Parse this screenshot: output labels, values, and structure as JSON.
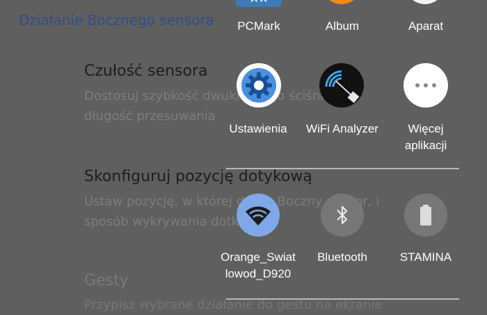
{
  "background": {
    "header": "Działanie Bocznego sensora",
    "items": [
      {
        "title": "Czułość sensora",
        "subtitle_line1": "Dostosuj szybkość dwukrotnego ściśnięcia i",
        "subtitle_line2": "długość przesuwania"
      },
      {
        "title": "Skonfiguruj pozycję dotykową",
        "subtitle_line1": "Ustaw pozycję, w której działa Boczny sensor, i",
        "subtitle_line2": "sposób wykrywania dotknięcia"
      },
      {
        "title": "Gesty",
        "subtitle_line1": "Przypisz wybrane działanie do gestu na ekranie"
      }
    ]
  },
  "overlay": {
    "top_apps": [
      {
        "label": "PCMark",
        "icon": "pcmark-icon"
      },
      {
        "label": "Album",
        "icon": "album-icon"
      },
      {
        "label": "Aparat",
        "icon": "camera-icon"
      }
    ],
    "apps": [
      {
        "label": "Ustawienia",
        "icon": "gear-icon",
        "color": "#4a90e2"
      },
      {
        "label": "WiFi Analyzer",
        "icon": "wifi-analyzer-icon",
        "color": "#1a1a1a"
      },
      {
        "label_line1": "Więcej",
        "label_line2": "aplikacji",
        "icon": "more-icon",
        "color": "#ffffff"
      }
    ],
    "toggles": [
      {
        "label_line1": "Orange_Swiat",
        "label_line2": "lowod_D920",
        "icon": "wifi-icon",
        "state": "on",
        "color": "#7fa8e8"
      },
      {
        "label": "Bluetooth",
        "icon": "bluetooth-icon",
        "state": "off"
      },
      {
        "label": "STAMINA",
        "icon": "battery-icon",
        "state": "off"
      }
    ]
  }
}
